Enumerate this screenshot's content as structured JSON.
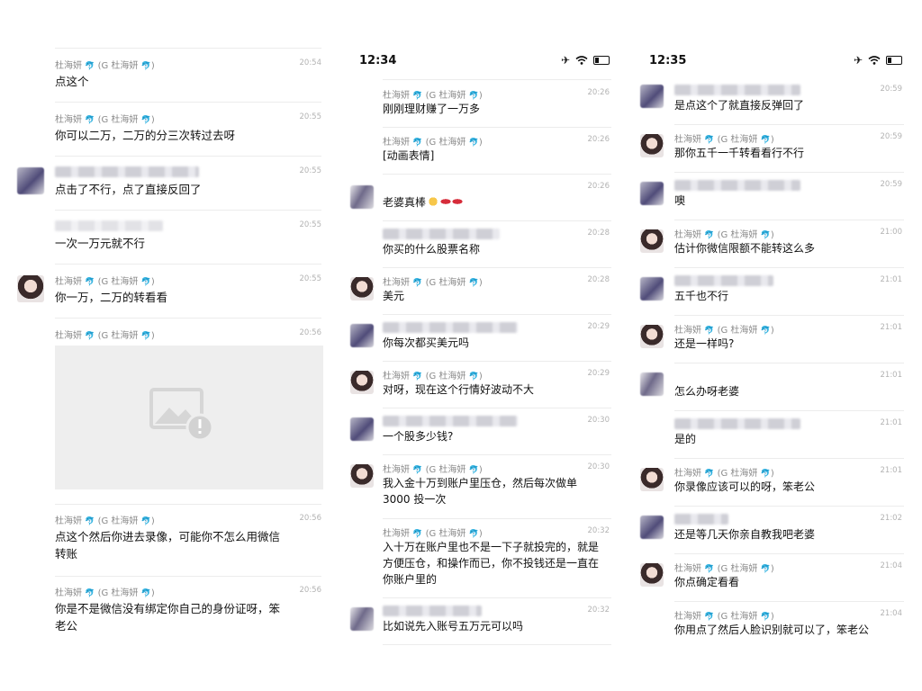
{
  "panel1": {
    "messages": [
      {
        "sender": "杜海妍",
        "alias": "(G 杜海妍",
        "time": "20:54",
        "text": "点这个"
      },
      {
        "sender": "杜海妍",
        "alias": "(G 杜海妍",
        "time": "20:55",
        "text": "你可以二万，二万的分三次转过去呀"
      },
      {
        "sender": "",
        "alias": "",
        "time": "20:55",
        "text": "点击了不行，点了直接反回了"
      },
      {
        "sender": "",
        "alias": "",
        "time": "20:55",
        "text": "一次一万元就不行"
      },
      {
        "sender": "杜海妍",
        "alias": "(G 杜海妍",
        "time": "20:55",
        "text": "你一万，二万的转看看"
      },
      {
        "sender": "杜海妍",
        "alias": "(G 杜海妍",
        "time": "20:56",
        "text": ""
      },
      {
        "sender": "杜海妍",
        "alias": "(G 杜海妍",
        "time": "20:56",
        "text": "点这个然后你进去录像，可能你不怎么用微信",
        "text2": "转账"
      },
      {
        "sender": "杜海妍",
        "alias": "(G 杜海妍",
        "time": "20:56",
        "text": "你是不是微信没有绑定你自己的身份证呀，笨",
        "text2": "老公"
      }
    ]
  },
  "panel2": {
    "status_time": "12:34",
    "messages": [
      {
        "sender": "杜海妍",
        "alias": "(G 杜海妍",
        "time": "20:26",
        "text": "刚刚理财赚了一万多"
      },
      {
        "sender": "杜海妍",
        "alias": "(G 杜海妍",
        "time": "20:26",
        "text": "[动画表情]"
      },
      {
        "sender": "",
        "alias": "",
        "time": "20:26",
        "text": "老婆真棒"
      },
      {
        "sender": "",
        "alias": "",
        "time": "20:28",
        "text": "你买的什么股票名称"
      },
      {
        "sender": "杜海妍",
        "alias": "(G 杜海妍",
        "time": "20:28",
        "text": "美元"
      },
      {
        "sender": "",
        "alias": "",
        "time": "20:29",
        "text": "你每次都买美元吗"
      },
      {
        "sender": "杜海妍",
        "alias": "(G 杜海妍",
        "time": "20:29",
        "text": "对呀，现在这个行情好波动不大"
      },
      {
        "sender": "",
        "alias": "",
        "time": "20:30",
        "text": "一个股多少钱?"
      },
      {
        "sender": "杜海妍",
        "alias": "(G 杜海妍",
        "time": "20:30",
        "text": "我入金十万到账户里压仓，然后每次做单",
        "text2": "3000 投一次"
      },
      {
        "sender": "杜海妍",
        "alias": "(G 杜海妍",
        "time": "20:32",
        "text": "入十万在账户里也不是一下子就投完的，就是",
        "text2": "方便压仓，和操作而已，你不投钱还是一直在",
        "text3": "你账户里的"
      },
      {
        "sender": "",
        "alias": "",
        "time": "20:32",
        "text": "比如说先入账号五万元可以吗"
      }
    ]
  },
  "panel3": {
    "status_time": "12:35",
    "messages": [
      {
        "sender": "",
        "alias": "",
        "time": "20:59",
        "text": "是点这个了就直接反弹回了"
      },
      {
        "sender": "杜海妍",
        "alias": "(G 杜海妍",
        "time": "20:59",
        "text": "那你五千一千转看看行不行"
      },
      {
        "sender": "",
        "alias": "",
        "time": "20:59",
        "text": "噢"
      },
      {
        "sender": "杜海妍",
        "alias": "(G 杜海妍",
        "time": "21:00",
        "text": "估计你微信限额不能转这么多"
      },
      {
        "sender": "",
        "alias": "",
        "time": "21:01",
        "text": "五千也不行"
      },
      {
        "sender": "杜海妍",
        "alias": "(G 杜海妍",
        "time": "21:01",
        "text": "还是一样吗?"
      },
      {
        "sender": "",
        "alias": "",
        "time": "21:01",
        "text": "怎么办呀老婆"
      },
      {
        "sender": "",
        "alias": "",
        "time": "21:01",
        "text": "是的"
      },
      {
        "sender": "杜海妍",
        "alias": "(G 杜海妍",
        "time": "21:01",
        "text": "你录像应该可以的呀，笨老公"
      },
      {
        "sender": "",
        "alias": "",
        "time": "21:02",
        "text": "还是等几天你亲自教我吧老婆"
      },
      {
        "sender": "杜海妍",
        "alias": "(G 杜海妍",
        "time": "21:04",
        "text": "你点确定看看"
      },
      {
        "sender": "杜海妍",
        "alias": "(G 杜海妍",
        "time": "21:04",
        "text": "你用点了然后人脸识别就可以了，笨老公"
      }
    ]
  },
  "icons": {
    "fish": "fish-emoji-icon",
    "broken_image": "broken-image-icon",
    "thumbs_up": "thumbs-up-emoji-icon",
    "lips": "lips-emoji-icon",
    "airplane": "airplane-mode-icon",
    "wifi": "wifi-icon",
    "battery": "battery-icon"
  }
}
